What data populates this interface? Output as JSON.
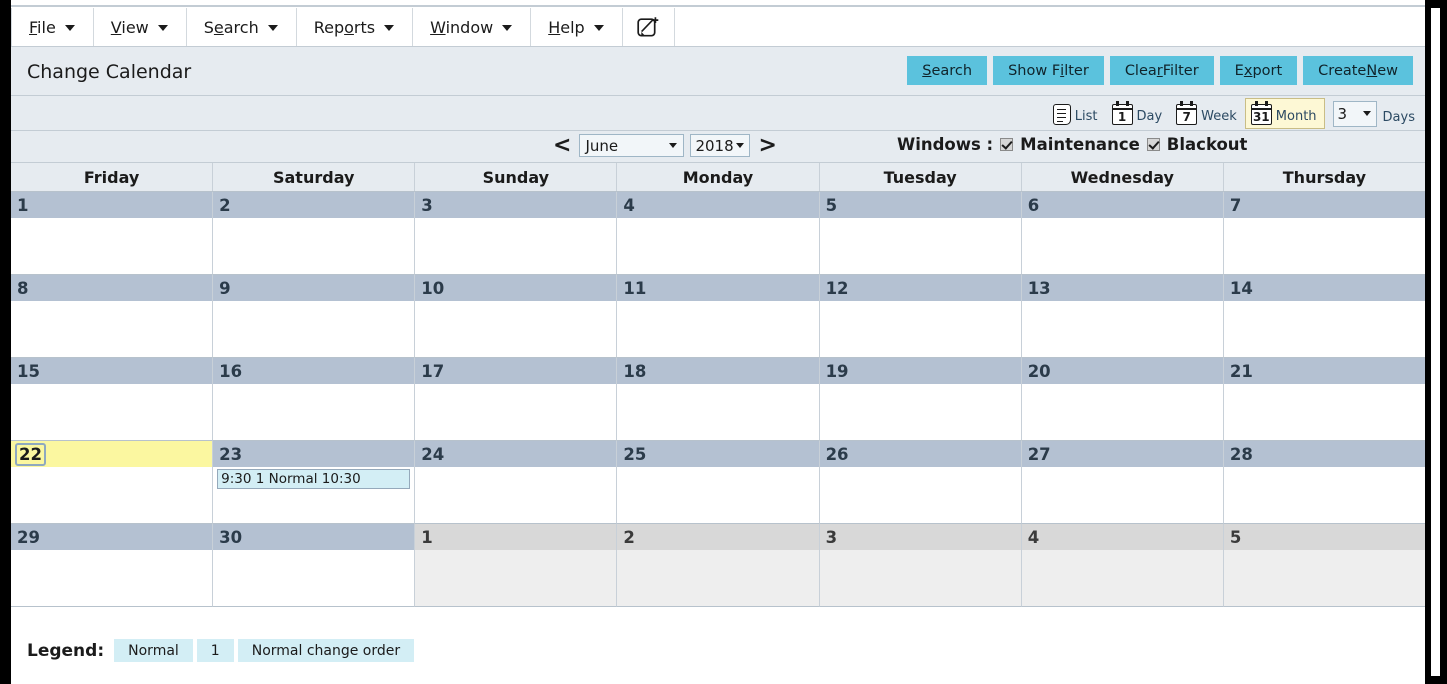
{
  "menu": {
    "items": [
      {
        "label": "File",
        "accel": "F",
        "icon": "chevron-down-icon"
      },
      {
        "label": "View",
        "accel": "V",
        "icon": "chevron-down-icon"
      },
      {
        "label": "Search",
        "accel": "e",
        "icon": "chevron-down-icon"
      },
      {
        "label": "Reports",
        "accel": "o",
        "icon": "chevron-down-icon"
      },
      {
        "label": "Window",
        "accel": "W",
        "icon": "chevron-down-icon"
      },
      {
        "label": "Help",
        "accel": "H",
        "icon": "chevron-down-icon"
      }
    ],
    "new_window_icon": "new-window-pencil-icon"
  },
  "header": {
    "title": "Change Calendar",
    "actions": [
      {
        "label": "Search",
        "accel": "S"
      },
      {
        "label": "Show Filter",
        "accel": "i"
      },
      {
        "label": "Clear Filter",
        "accel": "r"
      },
      {
        "label": "Export",
        "accel": "x"
      },
      {
        "label": "Create New",
        "accel": "N"
      }
    ]
  },
  "viewbar": {
    "modes": [
      {
        "label": "List",
        "icon": "list-icon",
        "glyph": "",
        "active": false
      },
      {
        "label": "Day",
        "icon": "calendar-day-icon",
        "glyph": "1",
        "active": false
      },
      {
        "label": "Week",
        "icon": "calendar-week-icon",
        "glyph": "7",
        "active": false
      },
      {
        "label": "Month",
        "icon": "calendar-month-icon",
        "glyph": "31",
        "active": true
      }
    ],
    "days_value": "3",
    "days_label": "Days"
  },
  "nav": {
    "prev_label": "<",
    "next_label": ">",
    "month": "June",
    "year": "2018",
    "windows_label": "Windows :",
    "windows": [
      {
        "label": "Maintenance",
        "checked": true
      },
      {
        "label": "Blackout",
        "checked": true
      }
    ]
  },
  "calendar": {
    "day_headers": [
      "Friday",
      "Saturday",
      "Sunday",
      "Monday",
      "Tuesday",
      "Wednesday",
      "Thursday"
    ],
    "weeks": [
      [
        {
          "num": "1",
          "other": false,
          "today": false,
          "events": []
        },
        {
          "num": "2",
          "other": false,
          "today": false,
          "events": []
        },
        {
          "num": "3",
          "other": false,
          "today": false,
          "events": []
        },
        {
          "num": "4",
          "other": false,
          "today": false,
          "events": []
        },
        {
          "num": "5",
          "other": false,
          "today": false,
          "events": []
        },
        {
          "num": "6",
          "other": false,
          "today": false,
          "events": []
        },
        {
          "num": "7",
          "other": false,
          "today": false,
          "events": []
        }
      ],
      [
        {
          "num": "8",
          "other": false,
          "today": false,
          "events": []
        },
        {
          "num": "9",
          "other": false,
          "today": false,
          "events": []
        },
        {
          "num": "10",
          "other": false,
          "today": false,
          "events": []
        },
        {
          "num": "11",
          "other": false,
          "today": false,
          "events": []
        },
        {
          "num": "12",
          "other": false,
          "today": false,
          "events": []
        },
        {
          "num": "13",
          "other": false,
          "today": false,
          "events": []
        },
        {
          "num": "14",
          "other": false,
          "today": false,
          "events": []
        }
      ],
      [
        {
          "num": "15",
          "other": false,
          "today": false,
          "events": []
        },
        {
          "num": "16",
          "other": false,
          "today": false,
          "events": []
        },
        {
          "num": "17",
          "other": false,
          "today": false,
          "events": []
        },
        {
          "num": "18",
          "other": false,
          "today": false,
          "events": []
        },
        {
          "num": "19",
          "other": false,
          "today": false,
          "events": []
        },
        {
          "num": "20",
          "other": false,
          "today": false,
          "events": []
        },
        {
          "num": "21",
          "other": false,
          "today": false,
          "events": []
        }
      ],
      [
        {
          "num": "22",
          "other": false,
          "today": true,
          "events": []
        },
        {
          "num": "23",
          "other": false,
          "today": false,
          "events": [
            "9:30 1 Normal 10:30"
          ]
        },
        {
          "num": "24",
          "other": false,
          "today": false,
          "events": []
        },
        {
          "num": "25",
          "other": false,
          "today": false,
          "events": []
        },
        {
          "num": "26",
          "other": false,
          "today": false,
          "events": []
        },
        {
          "num": "27",
          "other": false,
          "today": false,
          "events": []
        },
        {
          "num": "28",
          "other": false,
          "today": false,
          "events": []
        }
      ],
      [
        {
          "num": "29",
          "other": false,
          "today": false,
          "events": []
        },
        {
          "num": "30",
          "other": false,
          "today": false,
          "events": []
        },
        {
          "num": "1",
          "other": true,
          "today": false,
          "events": []
        },
        {
          "num": "2",
          "other": true,
          "today": false,
          "events": []
        },
        {
          "num": "3",
          "other": true,
          "today": false,
          "events": []
        },
        {
          "num": "4",
          "other": true,
          "today": false,
          "events": []
        },
        {
          "num": "5",
          "other": true,
          "today": false,
          "events": []
        }
      ]
    ]
  },
  "legend": {
    "title": "Legend:",
    "chips": [
      "Normal",
      "1",
      "Normal change order"
    ]
  },
  "colors": {
    "accent": "#5bc2dd",
    "day_header": "#b4c1d2",
    "today": "#fbf7a0",
    "event": "#d3eef5",
    "toolbar": "#e6ebf0"
  }
}
